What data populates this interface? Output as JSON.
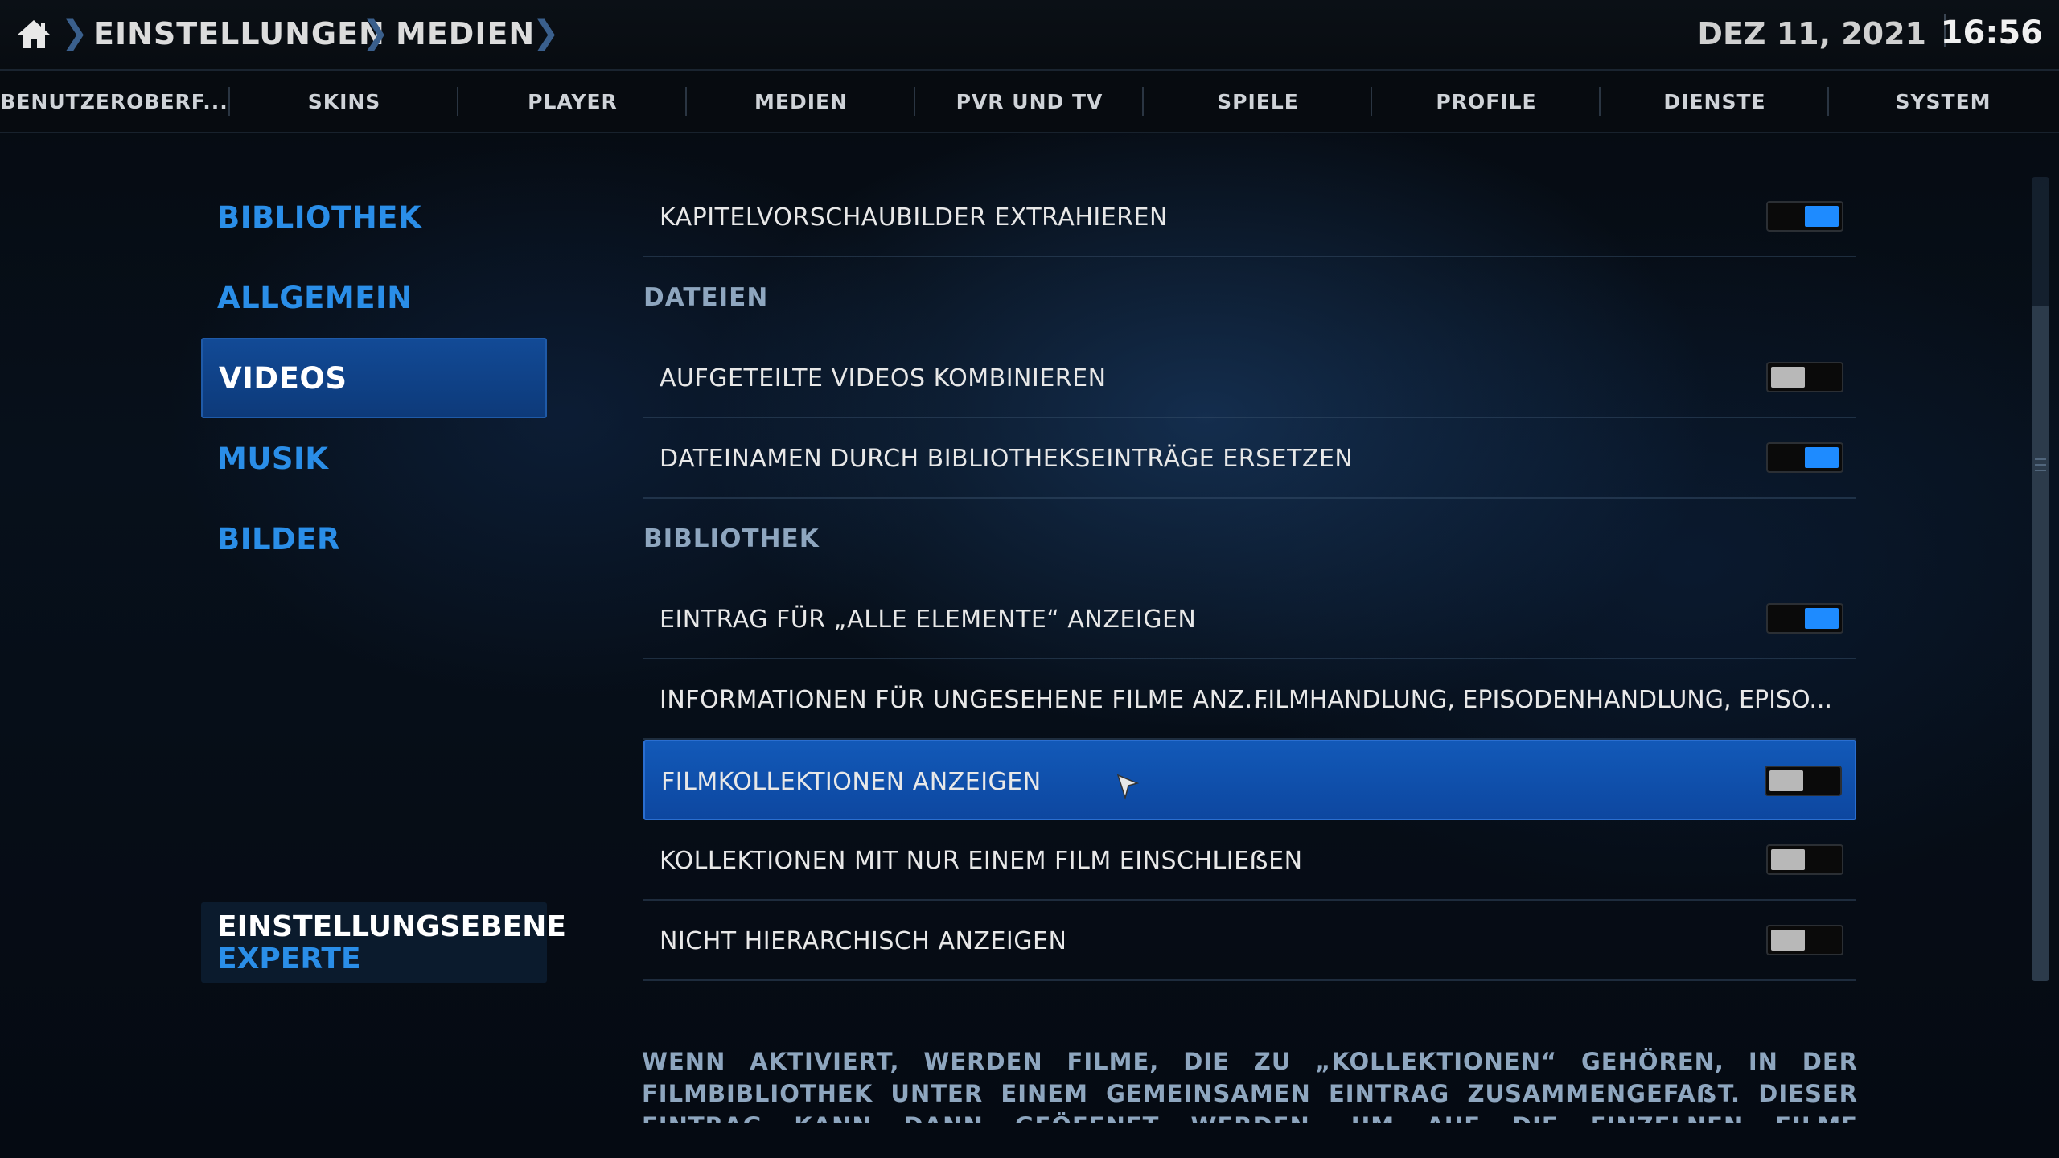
{
  "header": {
    "breadcrumb": [
      "EINSTELLUNGEN",
      "MEDIEN"
    ],
    "date": "DEZ 11, 2021",
    "time": "16:56"
  },
  "tabs": [
    "BENUTZEROBERF...",
    "SKINS",
    "PLAYER",
    "MEDIEN",
    "PVR UND TV",
    "SPIELE",
    "PROFILE",
    "DIENSTE",
    "SYSTEM"
  ],
  "sidebar": {
    "items": [
      "BIBLIOTHEK",
      "ALLGEMEIN",
      "VIDEOS",
      "MUSIK",
      "BILDER"
    ],
    "active": "VIDEOS",
    "level_title": "EINSTELLUNGSEBENE",
    "level_value": "EXPERTE"
  },
  "settings": {
    "chapter_thumbs": {
      "label": "KAPITELVORSCHAUBILDER EXTRAHIEREN",
      "state": "on"
    },
    "section_files": "DATEIEN",
    "combine_split": {
      "label": "AUFGETEILTE VIDEOS KOMBINIEREN",
      "state": "off"
    },
    "replace_filenames": {
      "label": "DATEINAMEN DURCH BIBLIOTHEKSEINTRÄGE ERSETZEN",
      "state": "on"
    },
    "section_library": "BIBLIOTHEK",
    "all_items": {
      "label": "EINTRAG FÜR „ALLE ELEMENTE“ ANZEIGEN",
      "state": "on"
    },
    "unwatched_info": {
      "label": "INFORMATIONEN FÜR UNGESEHENE FILME ANZ...",
      "value": "FILMHANDLUNG, EPISODENHANDLUNG, EPISO..."
    },
    "movie_sets": {
      "label": "FILMKOLLEKTIONEN ANZEIGEN",
      "state": "off"
    },
    "single_movie_sets": {
      "label": "KOLLEKTIONEN MIT NUR EINEM FILM EINSCHLIEẞEN",
      "state": "off"
    },
    "flatten": {
      "label": "NICHT HIERARCHISCH ANZEIGEN",
      "state": "off"
    }
  },
  "description": "WENN AKTIVIERT, WERDEN FILME, DIE ZU „KOLLEKTIONEN“ GEHÖREN, IN DER FILMBIBLIOTHEK UNTER EINEM GEMEINSAMEN EINTRAG ZUSAMMENGEFAẞT. DIESER EINTRAG KANN DANN GEÖFFNET WERDEN, UM AUF DIE EINZELNEN FILME ZUZUGREIFEN. WENN DEAKTIVIERT, ERHÄLT JEDER FILM",
  "colors": {
    "accent": "#2a8ee8",
    "toggle_on": "#1e8bff",
    "selection": "#1259b8"
  }
}
